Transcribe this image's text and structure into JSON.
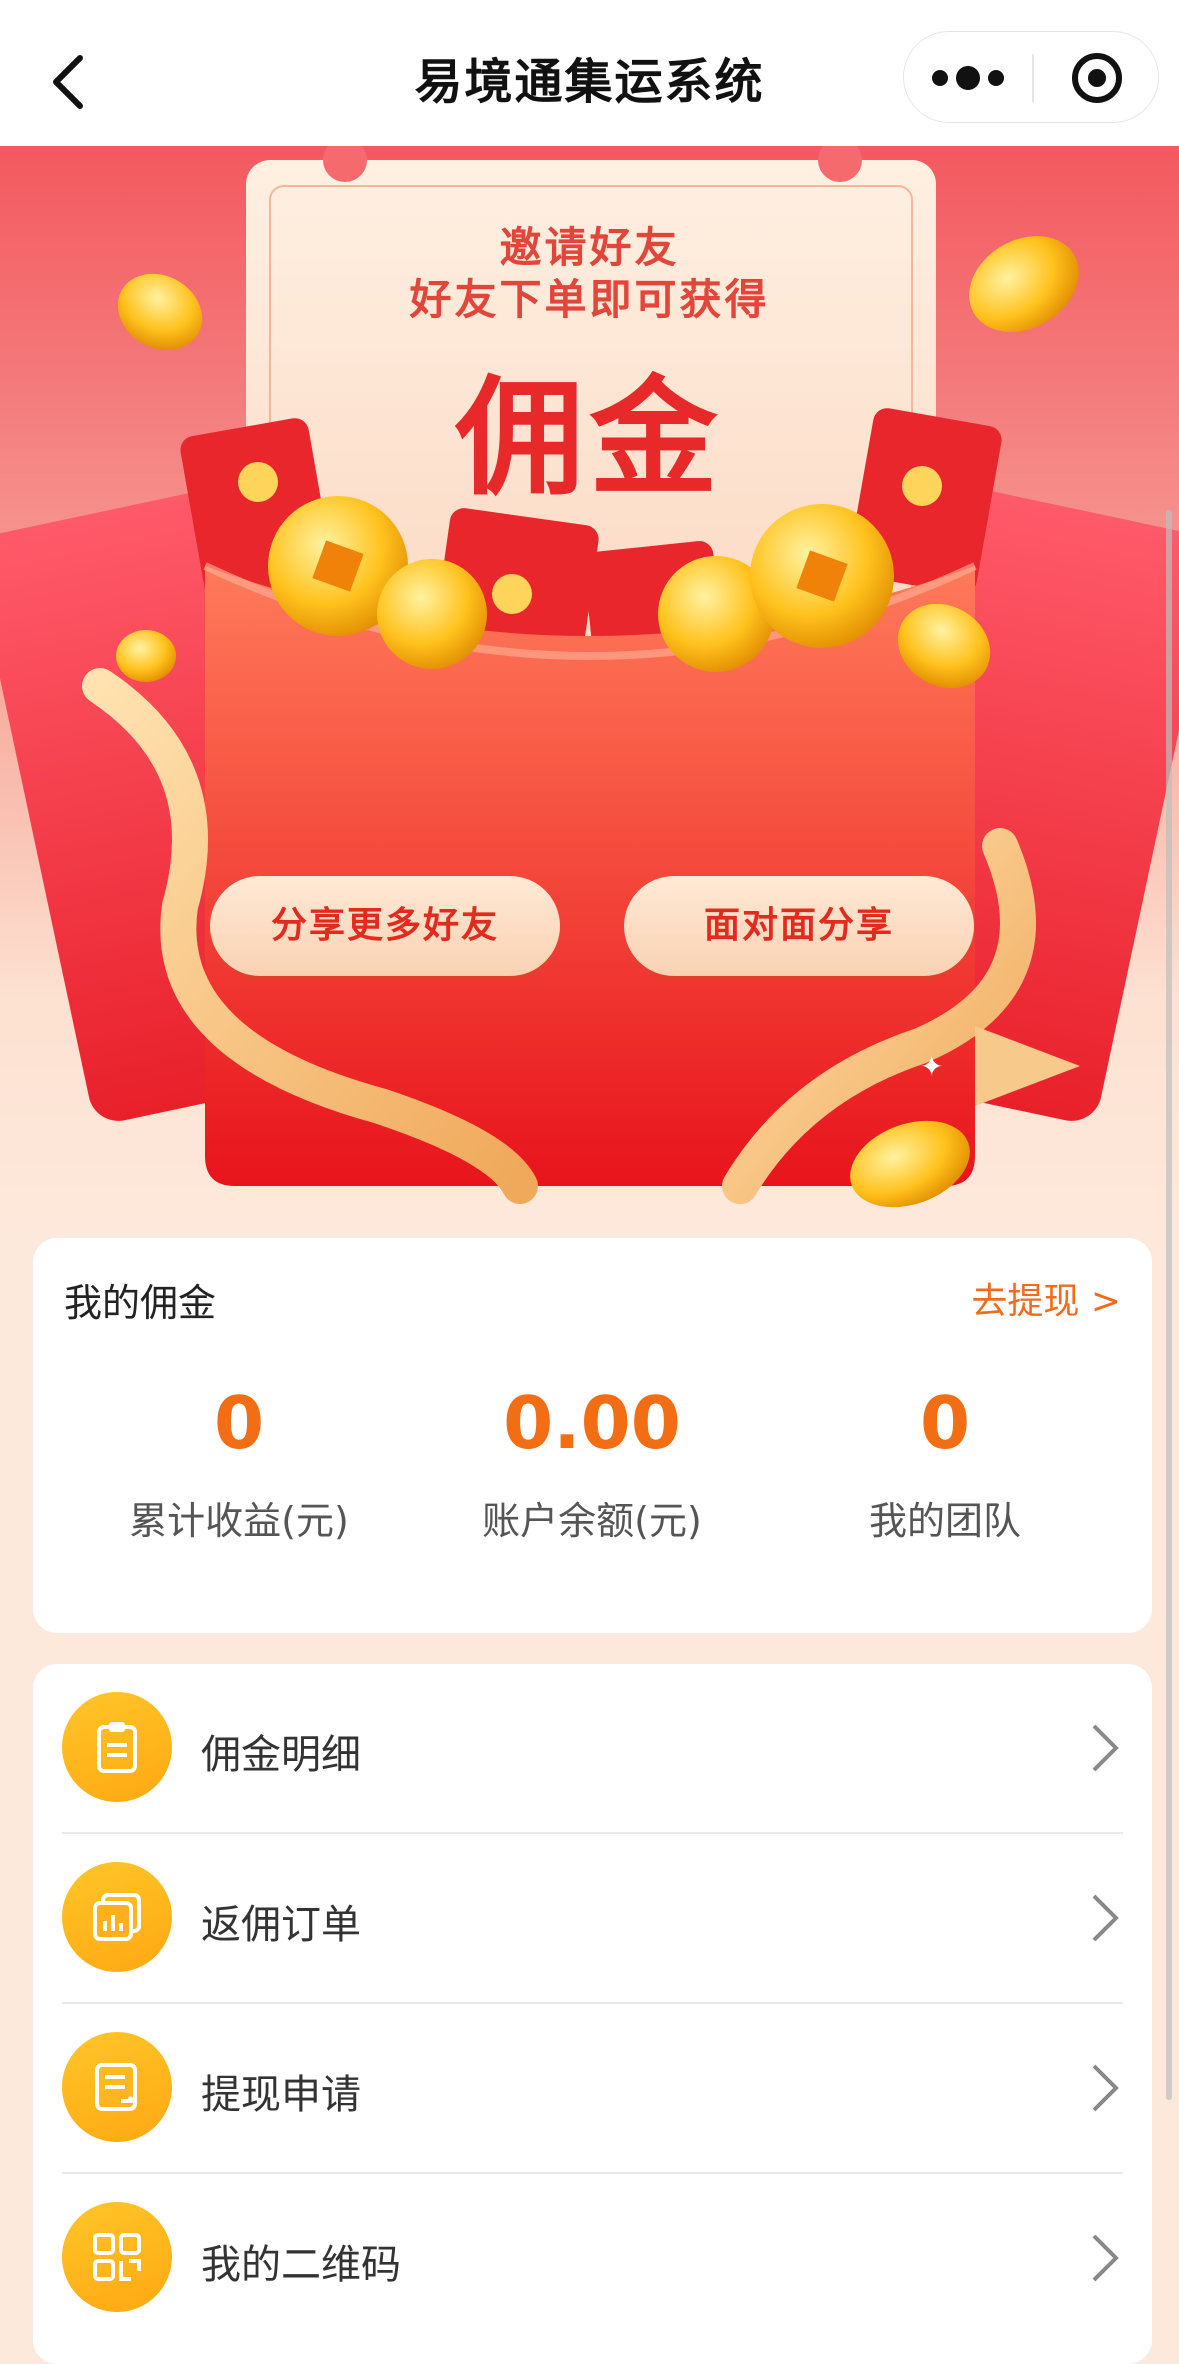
{
  "navbar": {
    "title": "易境通集运系统"
  },
  "hero": {
    "invite_line1": "邀请好友",
    "invite_line2": "好友下单即可获得",
    "commission_word": "佣金",
    "share_more_label": "分享更多好友",
    "share_face_label": "面对面分享"
  },
  "commission": {
    "title": "我的佣金",
    "withdraw_link": "去提现 >",
    "stats": [
      {
        "value": "0",
        "label": "累计收益(元)"
      },
      {
        "value": "0.00",
        "label": "账户余额(元)"
      },
      {
        "value": "0",
        "label": "我的团队"
      }
    ]
  },
  "menu": {
    "items": [
      {
        "label": "佣金明细",
        "icon": "clipboard-icon"
      },
      {
        "label": "返佣订单",
        "icon": "orders-icon"
      },
      {
        "label": "提现申请",
        "icon": "withdraw-form-icon"
      },
      {
        "label": "我的二维码",
        "icon": "qrcode-icon"
      }
    ]
  },
  "colors": {
    "accent_orange": "#f26d14",
    "hero_red": "#e8292a",
    "icon_yellow": "#ffb31c"
  }
}
